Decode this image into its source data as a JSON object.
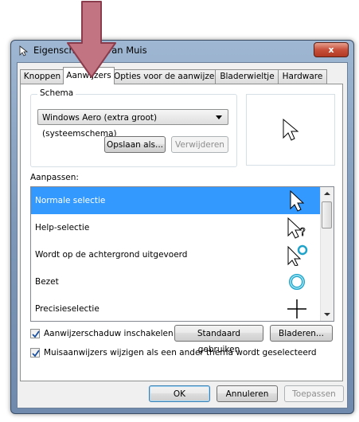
{
  "window": {
    "title": "Eigenschappen van Muis",
    "close_label": "x"
  },
  "tabs": [
    {
      "label": "Knoppen",
      "active": false
    },
    {
      "label": "Aanwijzers",
      "active": true
    },
    {
      "label": "Opties voor de aanwijzer",
      "active": false
    },
    {
      "label": "Bladerwieltje",
      "active": false
    },
    {
      "label": "Hardware",
      "active": false
    }
  ],
  "schema": {
    "group_label": "Schema",
    "selected": "Windows Aero (extra groot) (systeemschema)",
    "save_label": "Opslaan als...",
    "delete_label": "Verwijderen"
  },
  "customize": {
    "label": "Aanpassen:",
    "items": [
      {
        "label": "Normale selectie",
        "icon": "arrow-cursor-icon",
        "selected": true
      },
      {
        "label": "Help-selectie",
        "icon": "help-cursor-icon",
        "selected": false
      },
      {
        "label": "Wordt op de achtergrond uitgevoerd",
        "icon": "working-in-background-cursor-icon",
        "selected": false
      },
      {
        "label": "Bezet",
        "icon": "busy-cursor-icon",
        "selected": false
      },
      {
        "label": "Precisieselectie",
        "icon": "precision-cursor-icon",
        "selected": false
      }
    ]
  },
  "options": {
    "shadow_label": "Aanwijzerschaduw inschakelen",
    "shadow_checked": true,
    "default_label": "Standaard gebruiken",
    "browse_label": "Bladeren...",
    "theme_label": "Muisaanwijzers wijzigen als een ander thema wordt geselecteerd",
    "theme_checked": true
  },
  "footer": {
    "ok_label": "OK",
    "cancel_label": "Annuleren",
    "apply_label": "Toepassen"
  },
  "colors": {
    "selection": "#3399ff",
    "annotation_arrow": "#c27482"
  }
}
